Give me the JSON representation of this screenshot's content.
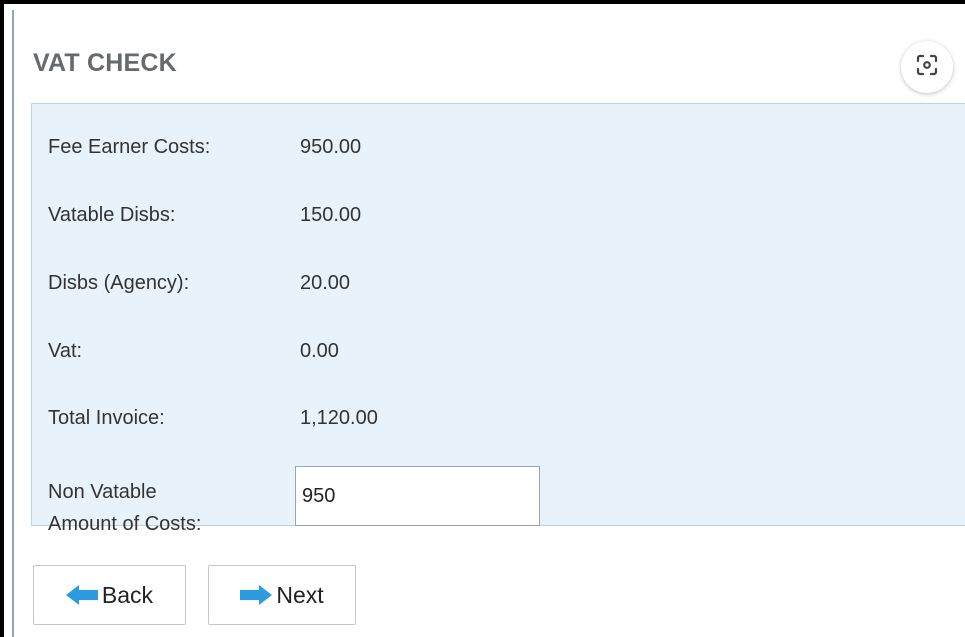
{
  "header": {
    "title": "VAT CHECK",
    "scan_icon": "focus-scan-icon"
  },
  "summary": {
    "fee_earner_costs": {
      "label": "Fee Earner Costs:",
      "value": "950.00"
    },
    "vatable_disbs": {
      "label": "Vatable Disbs:",
      "value": "150.00"
    },
    "disbs_agency": {
      "label": "Disbs (Agency):",
      "value": "20.00"
    },
    "vat": {
      "label": "Vat:",
      "value": "0.00"
    },
    "total_invoice": {
      "label": "Total Invoice:",
      "value": "1,120.00"
    }
  },
  "non_vatable": {
    "label_line1": "Non Vatable",
    "label_line2": "Amount of Costs:",
    "value": "950"
  },
  "buttons": {
    "back_label": "Back",
    "back_icon": "arrow-left-icon",
    "next_label": "Next",
    "next_icon": "arrow-right-icon"
  },
  "colors": {
    "panel_background": "#e8f2fb",
    "arrow_blue": "#2d9be0",
    "title_gray": "#666a6e"
  }
}
